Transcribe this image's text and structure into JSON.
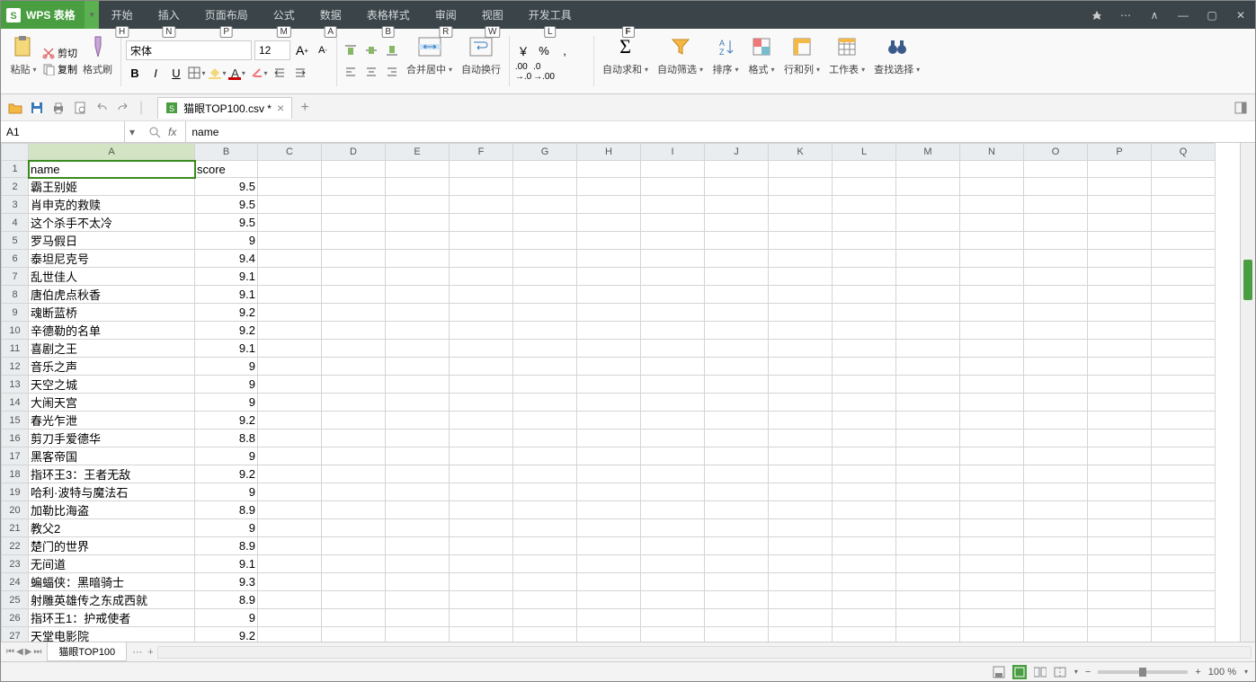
{
  "app": {
    "name": "WPS 表格",
    "keytip": "F"
  },
  "menu": [
    {
      "label": "开始",
      "key": "H"
    },
    {
      "label": "插入",
      "key": "N"
    },
    {
      "label": "页面布局",
      "key": "P"
    },
    {
      "label": "公式",
      "key": "M"
    },
    {
      "label": "数据",
      "key": "A"
    },
    {
      "label": "表格样式",
      "key": "B"
    },
    {
      "label": "审阅",
      "key": "R"
    },
    {
      "label": "视图",
      "key": "W"
    },
    {
      "label": "开发工具",
      "key": "L"
    }
  ],
  "ribbon": {
    "paste": "粘贴",
    "cut": "剪切",
    "copy": "复制",
    "format_painter": "格式刷",
    "font_name": "宋体",
    "font_size": "12",
    "merge_center": "合并居中",
    "wrap_text": "自动换行",
    "currency": "￥",
    "percent": "%",
    "comma": ",",
    "autosum": "自动求和",
    "autofilter": "自动筛选",
    "sort": "排序",
    "format": "格式",
    "rows_cols": "行和列",
    "worksheet": "工作表",
    "find_select": "查找选择"
  },
  "doc_tab": "猫眼TOP100.csv *",
  "namebox": "A1",
  "formula": "name",
  "columns": [
    "A",
    "B",
    "C",
    "D",
    "E",
    "F",
    "G",
    "H",
    "I",
    "J",
    "K",
    "L",
    "M",
    "N",
    "O",
    "P",
    "Q"
  ],
  "rows": [
    {
      "n": 1,
      "a": "name",
      "b": "score"
    },
    {
      "n": 2,
      "a": "霸王别姬",
      "b": "9.5"
    },
    {
      "n": 3,
      "a": "肖申克的救赎",
      "b": "9.5"
    },
    {
      "n": 4,
      "a": "这个杀手不太冷",
      "b": "9.5"
    },
    {
      "n": 5,
      "a": "罗马假日",
      "b": "9"
    },
    {
      "n": 6,
      "a": "泰坦尼克号",
      "b": "9.4"
    },
    {
      "n": 7,
      "a": "乱世佳人",
      "b": "9.1"
    },
    {
      "n": 8,
      "a": "唐伯虎点秋香",
      "b": "9.1"
    },
    {
      "n": 9,
      "a": "魂断蓝桥",
      "b": "9.2"
    },
    {
      "n": 10,
      "a": "辛德勒的名单",
      "b": "9.2"
    },
    {
      "n": 11,
      "a": "喜剧之王",
      "b": "9.1"
    },
    {
      "n": 12,
      "a": "音乐之声",
      "b": "9"
    },
    {
      "n": 13,
      "a": "天空之城",
      "b": "9"
    },
    {
      "n": 14,
      "a": "大闹天宫",
      "b": "9"
    },
    {
      "n": 15,
      "a": "春光乍泄",
      "b": "9.2"
    },
    {
      "n": 16,
      "a": "剪刀手爱德华",
      "b": "8.8"
    },
    {
      "n": 17,
      "a": "黑客帝国",
      "b": "9"
    },
    {
      "n": 18,
      "a": "指环王3：王者无敌",
      "b": "9.2"
    },
    {
      "n": 19,
      "a": "哈利·波特与魔法石",
      "b": "9"
    },
    {
      "n": 20,
      "a": "加勒比海盗",
      "b": "8.9"
    },
    {
      "n": 21,
      "a": "教父2",
      "b": "9"
    },
    {
      "n": 22,
      "a": "楚门的世界",
      "b": "8.9"
    },
    {
      "n": 23,
      "a": "无间道",
      "b": "9.1"
    },
    {
      "n": 24,
      "a": "蝙蝠侠：黑暗骑士",
      "b": "9.3"
    },
    {
      "n": 25,
      "a": "射雕英雄传之东成西就",
      "b": "8.9"
    },
    {
      "n": 26,
      "a": "指环王1：护戒使者",
      "b": "9"
    },
    {
      "n": 27,
      "a": "天堂电影院",
      "b": "9.2"
    }
  ],
  "sheet_name": "猫眼TOP100",
  "zoom": "100 %"
}
